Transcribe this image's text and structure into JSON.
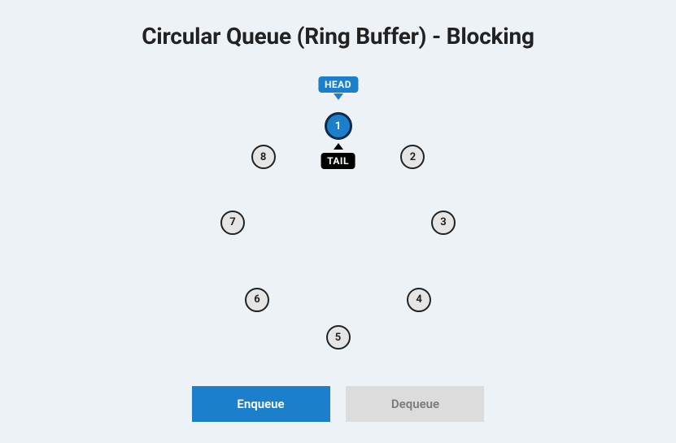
{
  "title": "Circular Queue (Ring Buffer) - Blocking",
  "head_label": "HEAD",
  "tail_label": "TAIL",
  "nodes": [
    {
      "label": "1",
      "filled": true,
      "angle_deg": -90
    },
    {
      "label": "2",
      "filled": false,
      "angle_deg": -45
    },
    {
      "label": "3",
      "filled": false,
      "angle_deg": -5
    },
    {
      "label": "4",
      "filled": false,
      "angle_deg": 40
    },
    {
      "label": "5",
      "filled": false,
      "angle_deg": 90
    },
    {
      "label": "6",
      "filled": false,
      "angle_deg": 140
    },
    {
      "label": "7",
      "filled": false,
      "angle_deg": 185
    },
    {
      "label": "8",
      "filled": false,
      "angle_deg": 225
    }
  ],
  "head_index": 0,
  "tail_index": 0,
  "buttons": {
    "enqueue": "Enqueue",
    "dequeue": "Dequeue"
  },
  "ring_radius": 130,
  "colors": {
    "primary": "#1b7fcc",
    "page_bg": "#edf2f7",
    "node_bg": "#e5e5e5",
    "tail_bg": "#000000"
  }
}
